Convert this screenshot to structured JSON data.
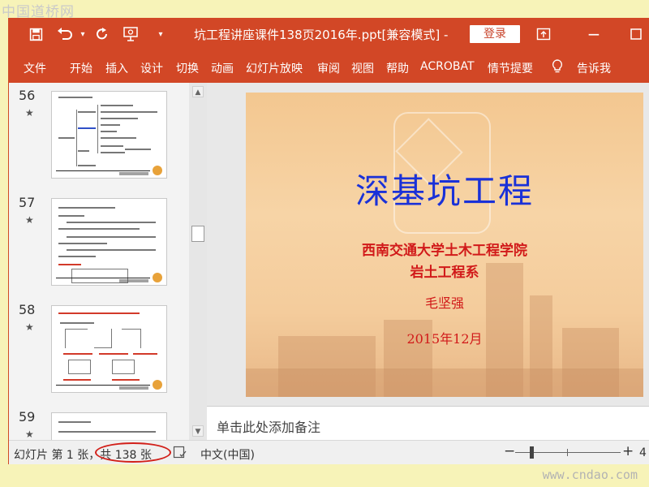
{
  "watermark": {
    "top": "中国道桥网",
    "bottom": "www.cndao.com"
  },
  "titlebar": {
    "title": "坑工程讲座课件138页2016年.ppt[兼容模式]  -",
    "login": "登录",
    "icons": [
      "save-icon",
      "undo-icon",
      "dropdown-icon",
      "redo-icon",
      "present-icon",
      "customize-icon",
      "restore-icon",
      "maximize-icon"
    ]
  },
  "ribbon": {
    "tabs": [
      "文件",
      "开始",
      "插入",
      "设计",
      "切换",
      "动画",
      "幻灯片放映",
      "审阅",
      "视图",
      "帮助",
      "ACROBAT",
      "情节提要"
    ],
    "tell_me": "告诉我"
  },
  "thumbnails": [
    {
      "number": "56",
      "star": "★"
    },
    {
      "number": "57",
      "star": "★"
    },
    {
      "number": "58",
      "star": "★"
    },
    {
      "number": "59",
      "star": "★"
    }
  ],
  "slide": {
    "title": "深基坑工程",
    "subtitle1": "西南交通大学土木工程学院",
    "subtitle2": "岩土工程系",
    "author": "毛坚强",
    "date": "2015年12月"
  },
  "notes": {
    "placeholder": "单击此处添加备注"
  },
  "statusbar": {
    "slide_info": "幻灯片 第 1 张，共 138 张",
    "language": "中文(中国)",
    "zoom_minus": "−",
    "zoom_plus": "+",
    "zoom_partial": "4"
  },
  "colors": {
    "accent": "#d24726",
    "slide_title": "#1a31d8",
    "slide_text": "#d11a1a",
    "highlight_oval": "#d2201a"
  }
}
